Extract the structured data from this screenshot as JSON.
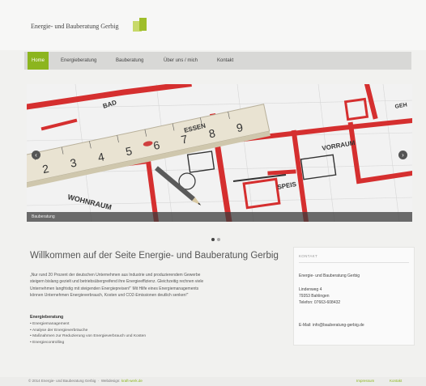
{
  "header": {
    "site_title": "Energie- und Bauberatung Gerbig",
    "accent": "#8cb51e"
  },
  "nav": {
    "items": [
      {
        "label": "Home",
        "active": true
      },
      {
        "label": "Energieberatung",
        "active": false
      },
      {
        "label": "Bauberatung",
        "active": false
      },
      {
        "label": "Über uns / mich",
        "active": false
      },
      {
        "label": "Kontakt",
        "active": false
      }
    ]
  },
  "slider": {
    "caption": "Bauberatung",
    "prev_icon": "‹",
    "next_icon": "›",
    "ruler_numbers": [
      "2",
      "3",
      "4",
      "5",
      "6",
      "7",
      "8",
      "9"
    ],
    "plan_labels": [
      "WOHNRAUM",
      "ESSEN",
      "VORRAUM",
      "SPEIS",
      "BAD",
      "GEH"
    ],
    "dots": 2,
    "active_dot": 0
  },
  "main": {
    "title": "Willkommen auf der Seite Energie- und Bauberatung Gerbig",
    "intro_lines": [
      "„Nur rund 20 Prozent der deutschen Unternehmen aus Industrie und produzierendem Gewerbe",
      "steigern bislang gezielt und betriebsübergreifend ihre Energieeffizienz. Gleichzeitig rechnen viele",
      "Unternehmen langfristig mit steigenden Energiepreisen!“ Mit Hilfe eines Energiemanagements",
      "können Unternehmen Energieverbrauch, Kosten und CO2-Emissionen deutlich senken!“"
    ],
    "list_title": "Energieberatung",
    "list_items": [
      "Energiemanagement",
      "Analyse der Energieverbräuche",
      "Maßnahmen zur Reduzierung von Energieverbrauch und Kosten",
      "Energiecontrolling"
    ]
  },
  "sidebar": {
    "widget_title": "KONTAKT",
    "company": "Energie- und Bauberatung Gerbig",
    "street": "Lindenweg 4",
    "city": "79353 Bahlingen",
    "phone": "Telefon: 07663-608432",
    "email": "E-Mail: info@bauberatung-gerbig.de"
  },
  "footer": {
    "copyright": "© 2014 Energie- und Bauberatung Gerbig",
    "credit_prefix": "Webdesign:",
    "credit_link": "kraft-werk.de",
    "links": [
      "Impressum",
      "Kontakt"
    ]
  }
}
